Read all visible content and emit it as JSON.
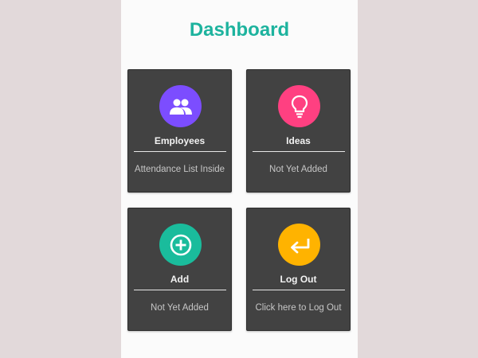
{
  "header": {
    "title": "Dashboard"
  },
  "colors": {
    "title": "#1db39e",
    "employees": "#7c4dff",
    "ideas": "#ff4081",
    "add": "#1abc9c",
    "logout": "#ffb300"
  },
  "cards": [
    {
      "label": "Employees",
      "subtitle": "Attendance List Inside",
      "icon": "people-icon"
    },
    {
      "label": "Ideas",
      "subtitle": "Not Yet Added",
      "icon": "lightbulb-icon"
    },
    {
      "label": "Add",
      "subtitle": "Not Yet Added",
      "icon": "add-circle-icon"
    },
    {
      "label": "Log Out",
      "subtitle": "Click here to Log Out",
      "icon": "return-arrow-icon"
    }
  ]
}
